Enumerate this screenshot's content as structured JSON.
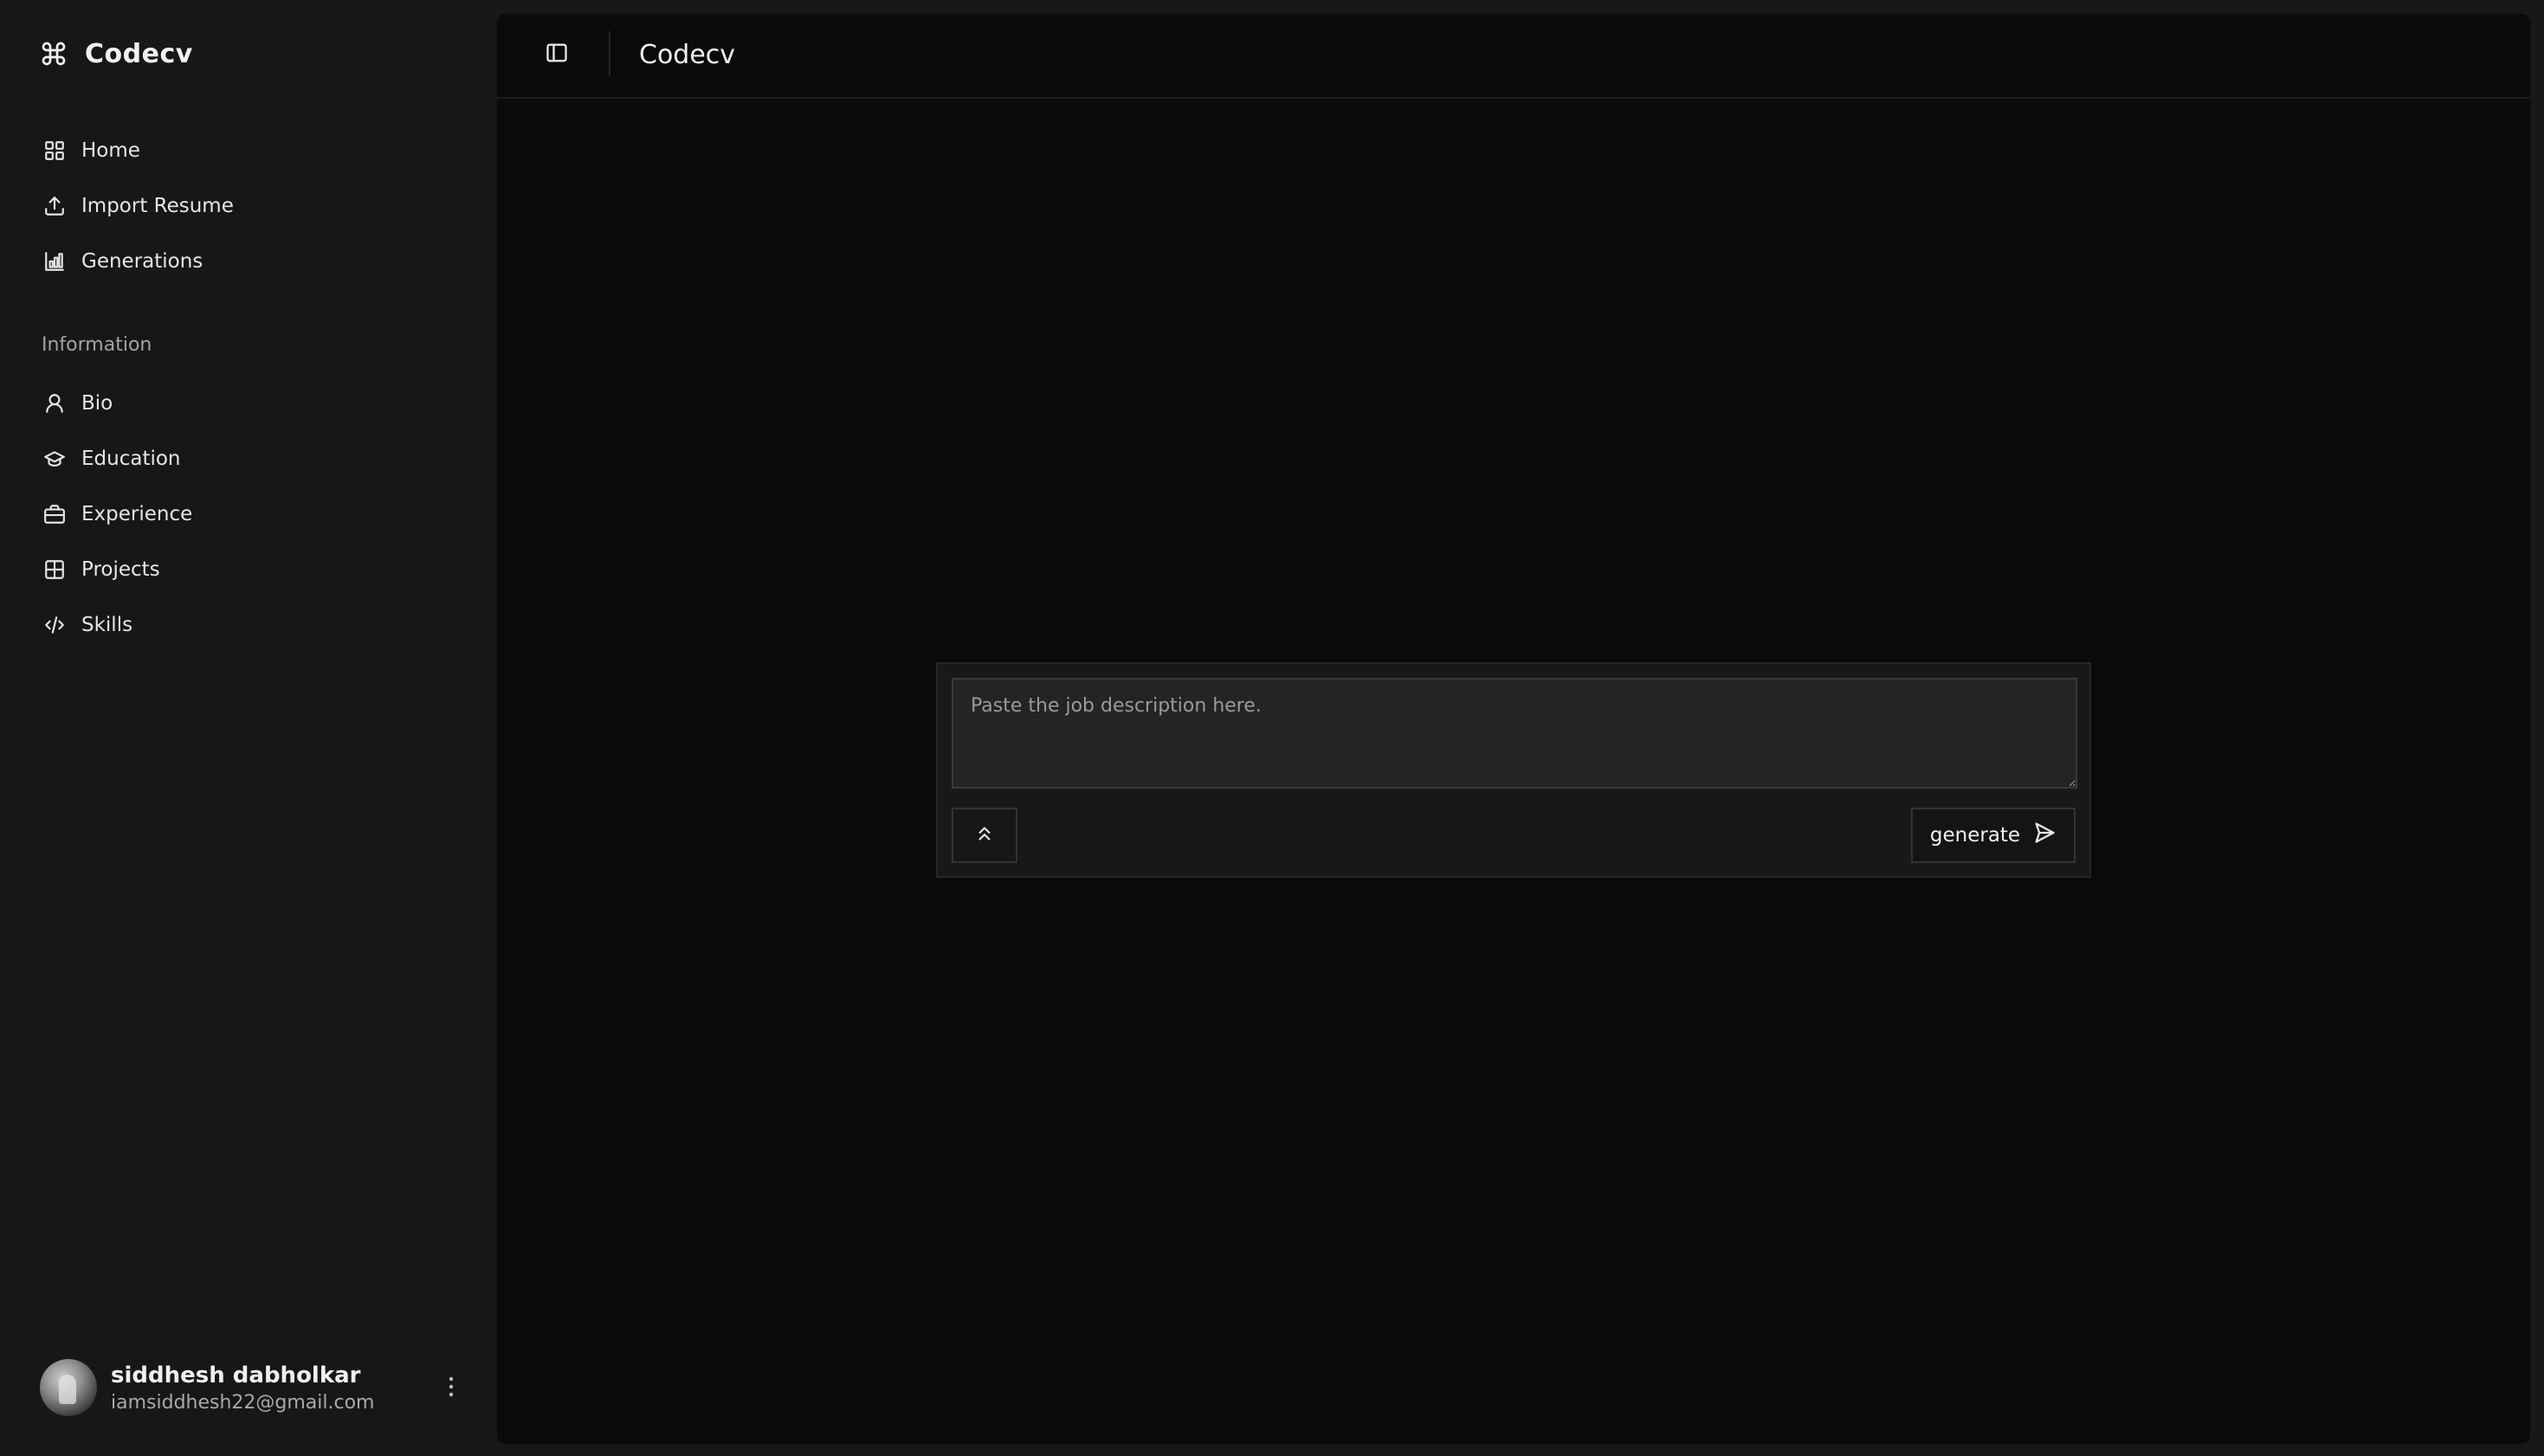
{
  "app": {
    "name": "Codecv"
  },
  "sidebar": {
    "main_items": [
      {
        "label": "Home",
        "icon": "grid-icon"
      },
      {
        "label": "Import Resume",
        "icon": "upload-icon"
      },
      {
        "label": "Generations",
        "icon": "bar-chart-icon"
      }
    ],
    "section_label": "Information",
    "info_items": [
      {
        "label": "Bio",
        "icon": "user-icon"
      },
      {
        "label": "Education",
        "icon": "graduation-cap-icon"
      },
      {
        "label": "Experience",
        "icon": "briefcase-icon"
      },
      {
        "label": "Projects",
        "icon": "table-icon"
      },
      {
        "label": "Skills",
        "icon": "code-icon"
      }
    ],
    "user": {
      "name": "siddhesh dabholkar",
      "email": "iamsiddhesh22@gmail.com"
    }
  },
  "header": {
    "title": "Codecv"
  },
  "composer": {
    "placeholder": "Paste the job description here.",
    "value": "",
    "generate_label": "generate"
  },
  "colors": {
    "sidebar_bg": "#171717",
    "main_bg": "#0a0a0a",
    "text": "#ededed",
    "muted": "#a3a3a3"
  }
}
